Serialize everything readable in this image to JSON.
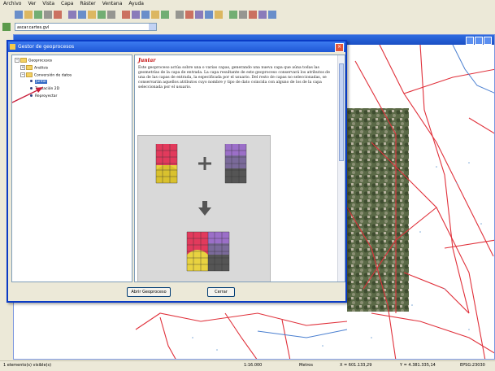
{
  "menu": [
    "Archivo",
    "Ver",
    "Vista",
    "Capa",
    "Ráster",
    "Ventana",
    "Ayuda"
  ],
  "toolbar": {
    "icons": [
      "new-icon",
      "open-icon",
      "save-icon",
      "print-icon",
      "zoom-in-icon",
      "zoom-out-icon",
      "zoom-icon",
      "pan-icon",
      "select-icon",
      "delete-icon",
      "copy-icon",
      "undo-icon",
      "info-icon",
      "layer-icon",
      "grid-icon",
      "raster-icon",
      "ruler-icon",
      "edit-icon",
      "point-icon",
      "line-icon",
      "polygon-icon",
      "table-icon",
      "chart-icon",
      "search-icon",
      "help-icon"
    ]
  },
  "combo": {
    "value": "ascar.cartes.gvl"
  },
  "dialog": {
    "title": "Gestor de geoprocesos",
    "close": "×",
    "tree": {
      "root": "Geoprocesos",
      "items": [
        {
          "label": "Análisis",
          "kind": "folder"
        },
        {
          "label": "Conversión de datos",
          "kind": "folder"
        },
        {
          "label": "Juntar",
          "kind": "leaf",
          "selected": true
        },
        {
          "label": "Traslación 2D",
          "kind": "leaf"
        },
        {
          "label": "Reproyectar",
          "kind": "leaf"
        }
      ]
    },
    "help": {
      "heading": "Juntar",
      "text": "Este geoproceso actúa sobre una o varias capas, generando una nueva capa que aúna todas las geometrías de la capa de entrada. La capa resultante de este geoproceso conservará los atributos de una de las capas de entrada, la especificada por el usuario. Del resto de capas no seleccionadas, se conservarán aquellos atributos cuyo nombre y tipo de dato coincida con alguno de los de la capa seleccionada por el usuario."
    },
    "buttons": {
      "open": "Abrir Geoproceso",
      "close": "Cerrar"
    }
  },
  "status": {
    "left": "1 elemento(s) visible(s)",
    "scale": "1:16.000",
    "units": "Metros",
    "x": "X = 601.133,29",
    "y": "Y = 4.381.335,14",
    "sys": "EPSG:23030"
  },
  "colors": {
    "title": "#1f57d6",
    "road": "#e0303a",
    "river": "#4a7fd0",
    "heading": "#c00000"
  }
}
